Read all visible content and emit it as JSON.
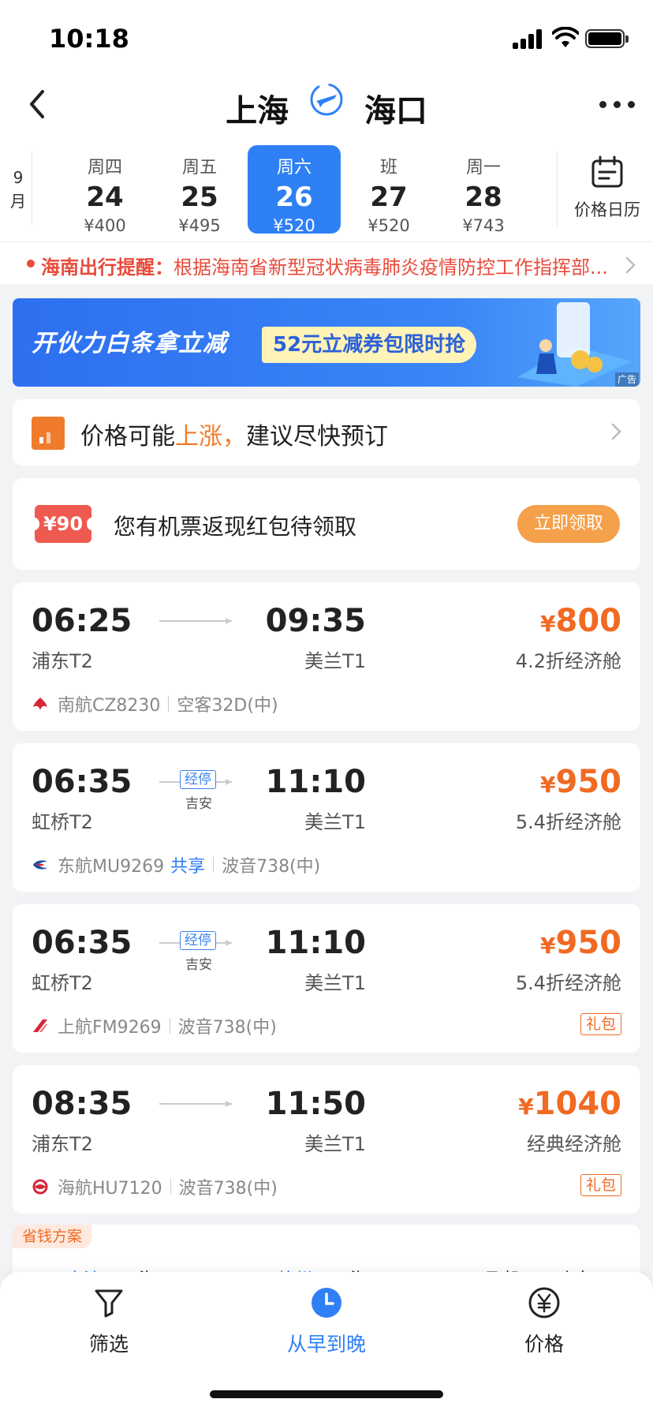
{
  "status_bar": {
    "time": "10:18"
  },
  "header": {
    "origin": "上海",
    "destination": "海口"
  },
  "date_bar": {
    "month_label": [
      "9",
      "月"
    ],
    "dates": [
      {
        "weekday": "周四",
        "day": "24",
        "price": "¥400",
        "selected": false
      },
      {
        "weekday": "周五",
        "day": "25",
        "price": "¥495",
        "selected": false
      },
      {
        "weekday": "周六",
        "day": "26",
        "price": "¥520",
        "selected": true
      },
      {
        "weekday": "班",
        "day": "27",
        "price": "¥520",
        "selected": false
      },
      {
        "weekday": "周一",
        "day": "28",
        "price": "¥743",
        "selected": false
      }
    ],
    "calendar_label": "价格日历"
  },
  "notice": {
    "title": "海南出行提醒：",
    "text": "根据海南省新型冠状病毒肺炎疫情防控工作指挥部..."
  },
  "banner": {
    "headline": "开伙力白条拿立减",
    "offer": "52元立减券包限时抢",
    "ad_label": "广告"
  },
  "price_alert": {
    "text_before": "价格可能",
    "highlight": "上涨，",
    "text_after": "建议尽快预订"
  },
  "red_packet": {
    "amount": "¥90",
    "text": "您有机票返现红包待领取",
    "button": "立即领取"
  },
  "flights": [
    {
      "dep_time": "06:25",
      "dep_airport": "浦东T2",
      "arr_time": "09:35",
      "arr_airport": "美兰T1",
      "stop_label": "",
      "stop_city": "",
      "price": "800",
      "cabin": "4.2折经济舱",
      "airline": "南航CZ8230",
      "shared": "",
      "aircraft": "空客32D(中)",
      "gift": "",
      "logo": "china-southern"
    },
    {
      "dep_time": "06:35",
      "dep_airport": "虹桥T2",
      "arr_time": "11:10",
      "arr_airport": "美兰T1",
      "stop_label": "经停",
      "stop_city": "吉安",
      "price": "950",
      "cabin": "5.4折经济舱",
      "airline": "东航MU9269",
      "shared": "共享",
      "aircraft": "波音738(中)",
      "gift": "",
      "logo": "china-eastern"
    },
    {
      "dep_time": "06:35",
      "dep_airport": "虹桥T2",
      "arr_time": "11:10",
      "arr_airport": "美兰T1",
      "stop_label": "经停",
      "stop_city": "吉安",
      "price": "950",
      "cabin": "5.4折经济舱",
      "airline": "上航FM9269",
      "shared": "",
      "aircraft": "波音738(中)",
      "gift": "礼包",
      "logo": "shanghai-airlines"
    },
    {
      "dep_time": "08:35",
      "dep_airport": "浦东T2",
      "arr_time": "11:50",
      "arr_airport": "美兰T1",
      "stop_label": "",
      "stop_city": "",
      "price": "1040",
      "cabin": "经典经济舱",
      "airline": "海航HU7120",
      "shared": "",
      "aircraft": "波音738(中)",
      "gift": "礼包",
      "logo": "hainan-airlines"
    }
  ],
  "flight_currency": "¥",
  "saving_plan": {
    "tag": "省钱方案",
    "peek": [
      "宁波",
      "海口",
      "杭州",
      "海口",
      "飞机",
      "火车"
    ]
  },
  "tabbar": [
    {
      "label": "筛选",
      "icon": "filter-icon",
      "active": false
    },
    {
      "label": "从早到晚",
      "icon": "clock-icon",
      "active": true
    },
    {
      "label": "价格",
      "icon": "yuan-icon",
      "active": false
    }
  ],
  "colors": {
    "accent": "#2f80f5",
    "price": "#f06a22",
    "alert_red": "#e94b3c"
  }
}
